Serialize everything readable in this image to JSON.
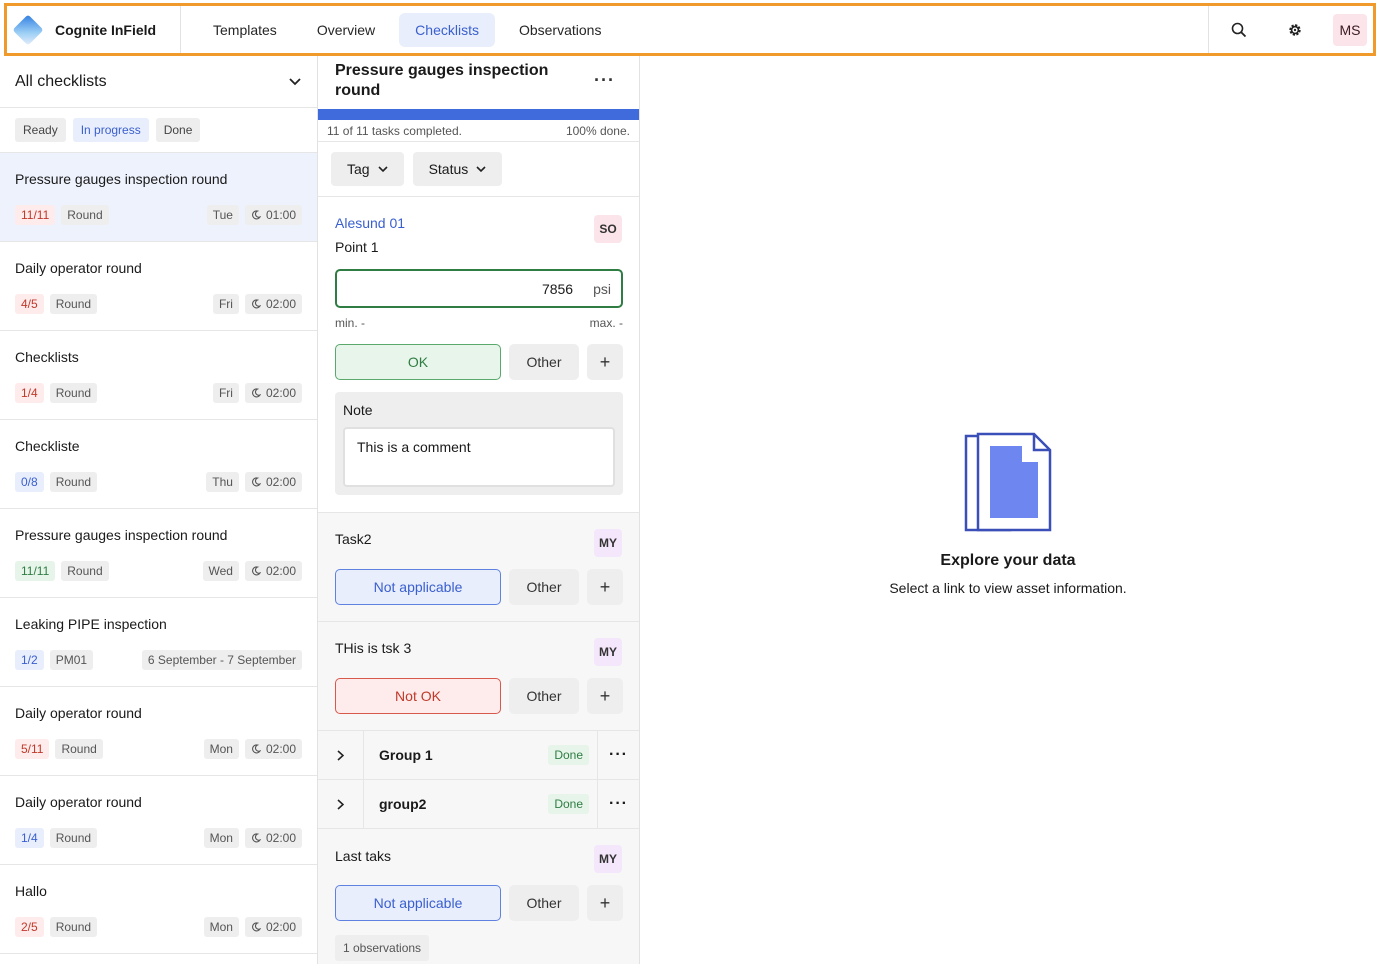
{
  "app": {
    "name": "Cognite InField"
  },
  "nav": {
    "tabs": [
      "Templates",
      "Overview",
      "Checklists",
      "Observations"
    ],
    "active": "Checklists"
  },
  "user": {
    "initials": "MS"
  },
  "left": {
    "title": "All checklists",
    "filters": [
      "Ready",
      "In progress",
      "Done"
    ],
    "selected_filter": "In progress",
    "items": [
      {
        "title": "Pressure gauges inspection round",
        "count": "11/11",
        "count_color": "red",
        "type": "Round",
        "day": "Tue",
        "time": "01:00",
        "selected": true
      },
      {
        "title": "Daily operator round",
        "count": "4/5",
        "count_color": "red",
        "type": "Round",
        "day": "Fri",
        "time": "02:00"
      },
      {
        "title": "Checklists",
        "count": "1/4",
        "count_color": "red",
        "type": "Round",
        "day": "Fri",
        "time": "02:00"
      },
      {
        "title": "Checkliste",
        "count": "0/8",
        "count_color": "blue",
        "type": "Round",
        "day": "Thu",
        "time": "02:00"
      },
      {
        "title": "Pressure gauges inspection round",
        "count": "11/11",
        "count_color": "green",
        "type": "Round",
        "day": "Wed",
        "time": "02:00"
      },
      {
        "title": "Leaking PIPE inspection",
        "count": "1/2",
        "count_color": "blue",
        "type": "PM01",
        "range": "6 September - 7 September"
      },
      {
        "title": "Daily operator round",
        "count": "5/11",
        "count_color": "red",
        "type": "Round",
        "day": "Mon",
        "time": "02:00"
      },
      {
        "title": "Daily operator round",
        "count": "1/4",
        "count_color": "blue",
        "type": "Round",
        "day": "Mon",
        "time": "02:00"
      },
      {
        "title": "Hallo",
        "count": "2/5",
        "count_color": "red",
        "type": "Round",
        "day": "Mon",
        "time": "02:00"
      }
    ]
  },
  "checklist": {
    "title": "Pressure gauges inspection round",
    "progress_fraction": 1.0,
    "progress_text": "11 of 11 tasks completed.",
    "progress_pct_text": "100% done.",
    "filters": [
      "Tag",
      "Status"
    ],
    "task1": {
      "asset": "Alesund 01",
      "name": "Point 1",
      "assignee": "SO",
      "value": "7856",
      "unit": "psi",
      "min": "min. -",
      "max": "max. -",
      "status": "OK",
      "other": "Other",
      "note_label": "Note",
      "note_text": "This is a comment"
    },
    "task2": {
      "name": "Task2",
      "assignee": "MY",
      "status": "Not applicable",
      "other": "Other"
    },
    "task3": {
      "name": "THis is tsk 3",
      "assignee": "MY",
      "status": "Not OK",
      "other": "Other"
    },
    "groups": [
      {
        "name": "Group 1",
        "status": "Done"
      },
      {
        "name": "group2",
        "status": "Done"
      }
    ],
    "task4": {
      "name": "Last taks",
      "assignee": "MY",
      "status": "Not applicable",
      "other": "Other",
      "observations": "1 observations"
    }
  },
  "empty_state": {
    "title": "Explore your data",
    "subtitle": "Select a link to view asset information."
  },
  "colors": {
    "accent": "#3f6bdc",
    "highlight_border": "#ef9a2b",
    "ok_green": "#2f7d43",
    "notok_red": "#c0392b"
  }
}
